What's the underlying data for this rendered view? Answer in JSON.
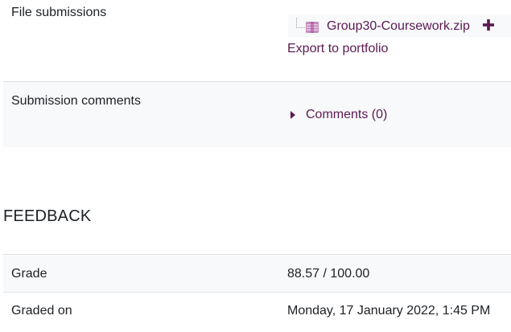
{
  "submission": {
    "file_submissions_label": "File submissions",
    "file_name": "Group30-Coursework.zip",
    "file_icon": "zip-archive-icon",
    "add_icon": "plus-icon",
    "export_link": "Export to portfolio",
    "comments_label": "Submission comments",
    "comments_link": "Comments (0)"
  },
  "feedback": {
    "heading": "FEEDBACK",
    "grade_label": "Grade",
    "grade_value": "88.57 / 100.00",
    "graded_on_label": "Graded on",
    "graded_on_value": "Monday, 17 January 2022, 1:45 PM"
  },
  "colors": {
    "link": "#5b1a52",
    "row_alt_bg": "#f8f9fa",
    "border": "#dee2e6",
    "text": "#1d2125"
  }
}
